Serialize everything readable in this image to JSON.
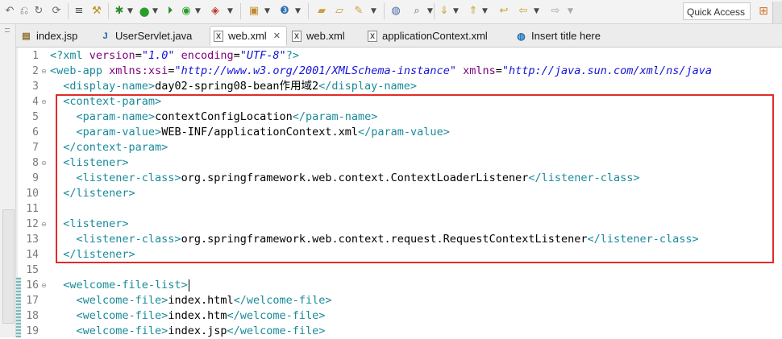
{
  "toolbar": {
    "quick_access_placeholder": "Quick Access"
  },
  "tabs": [
    {
      "label": "index.jsp",
      "icon": "jsp-file-icon"
    },
    {
      "label": "UserServlet.java",
      "icon": "java-file-icon"
    },
    {
      "label": "web.xml",
      "icon": "xml-file-icon",
      "active": true,
      "close": "✕"
    },
    {
      "label": "web.xml",
      "icon": "xml-file-icon"
    },
    {
      "label": "applicationContext.xml",
      "icon": "xml-file-icon"
    },
    {
      "label": "Insert title here",
      "icon": "browser-icon"
    }
  ],
  "editor": {
    "lines": [
      {
        "n": "1",
        "parts": [
          [
            "pi",
            "<?"
          ],
          [
            "tag",
            "xml "
          ],
          [
            "attr",
            "version"
          ],
          [
            "txt",
            "="
          ],
          [
            "val",
            "\"1.0\""
          ],
          [
            "txt",
            " "
          ],
          [
            "attr",
            "encoding"
          ],
          [
            "txt",
            "="
          ],
          [
            "val",
            "\"UTF-8\""
          ],
          [
            "pi",
            "?>"
          ]
        ]
      },
      {
        "n": "2",
        "fold": "minus",
        "parts": [
          [
            "tag",
            "<web-app "
          ],
          [
            "attr",
            "xmlns:xsi"
          ],
          [
            "txt",
            "="
          ],
          [
            "val",
            "\"http://www.w3.org/2001/XMLSchema-instance\""
          ],
          [
            "txt",
            " "
          ],
          [
            "attr",
            "xmlns"
          ],
          [
            "txt",
            "="
          ],
          [
            "val",
            "\"http://java.sun.com/xml/ns/java"
          ]
        ]
      },
      {
        "n": "3",
        "parts": [
          [
            "txt",
            "  "
          ],
          [
            "tag",
            "<display-name>"
          ],
          [
            "txt",
            "day02-spring08-bean作用域2"
          ],
          [
            "tag",
            "</display-name>"
          ]
        ]
      },
      {
        "n": "4",
        "fold": "minus",
        "parts": [
          [
            "txt",
            "  "
          ],
          [
            "tag",
            "<context-param>"
          ]
        ]
      },
      {
        "n": "5",
        "parts": [
          [
            "txt",
            "    "
          ],
          [
            "tag",
            "<param-name>"
          ],
          [
            "txt",
            "contextConfigLocation"
          ],
          [
            "tag",
            "</param-name>"
          ]
        ]
      },
      {
        "n": "6",
        "parts": [
          [
            "txt",
            "    "
          ],
          [
            "tag",
            "<param-value>"
          ],
          [
            "txt",
            "WEB-INF/applicationContext.xml"
          ],
          [
            "tag",
            "</param-value>"
          ]
        ]
      },
      {
        "n": "7",
        "parts": [
          [
            "txt",
            "  "
          ],
          [
            "tag",
            "</context-param>"
          ]
        ]
      },
      {
        "n": "8",
        "fold": "minus",
        "parts": [
          [
            "txt",
            "  "
          ],
          [
            "tag",
            "<listener>"
          ]
        ]
      },
      {
        "n": "9",
        "parts": [
          [
            "txt",
            "    "
          ],
          [
            "tag",
            "<listener-class>"
          ],
          [
            "txt",
            "org.springframework.web.context.ContextLoaderListener"
          ],
          [
            "tag",
            "</listener-class>"
          ]
        ]
      },
      {
        "n": "10",
        "parts": [
          [
            "txt",
            "  "
          ],
          [
            "tag",
            "</listener>"
          ]
        ]
      },
      {
        "n": "11",
        "parts": []
      },
      {
        "n": "12",
        "fold": "minus",
        "parts": [
          [
            "txt",
            "  "
          ],
          [
            "tag",
            "<listener>"
          ]
        ]
      },
      {
        "n": "13",
        "parts": [
          [
            "txt",
            "    "
          ],
          [
            "tag",
            "<listener-class>"
          ],
          [
            "txt",
            "org.springframework.web.context.request.RequestContextListener"
          ],
          [
            "tag",
            "</listener-class>"
          ]
        ]
      },
      {
        "n": "14",
        "parts": [
          [
            "txt",
            "  "
          ],
          [
            "tag",
            "</listener>"
          ]
        ]
      },
      {
        "n": "15",
        "parts": []
      },
      {
        "n": "16",
        "fold": "minus",
        "caret": true,
        "parts": [
          [
            "txt",
            "  "
          ],
          [
            "tag",
            "<welcome-file-list>"
          ]
        ]
      },
      {
        "n": "17",
        "parts": [
          [
            "txt",
            "    "
          ],
          [
            "tag",
            "<welcome-file>"
          ],
          [
            "txt",
            "index.html"
          ],
          [
            "tag",
            "</welcome-file>"
          ]
        ]
      },
      {
        "n": "18",
        "parts": [
          [
            "txt",
            "    "
          ],
          [
            "tag",
            "<welcome-file>"
          ],
          [
            "txt",
            "index.htm"
          ],
          [
            "tag",
            "</welcome-file>"
          ]
        ]
      },
      {
        "n": "19",
        "parts": [
          [
            "txt",
            "    "
          ],
          [
            "tag",
            "<welcome-file>"
          ],
          [
            "txt",
            "index.jsp"
          ],
          [
            "tag",
            "</welcome-file>"
          ]
        ]
      }
    ]
  },
  "colors": {
    "tag": "#1a8a9a",
    "attribute": "#7f007f",
    "value": "#1515d8",
    "highlight_box": "#e02b2b"
  }
}
